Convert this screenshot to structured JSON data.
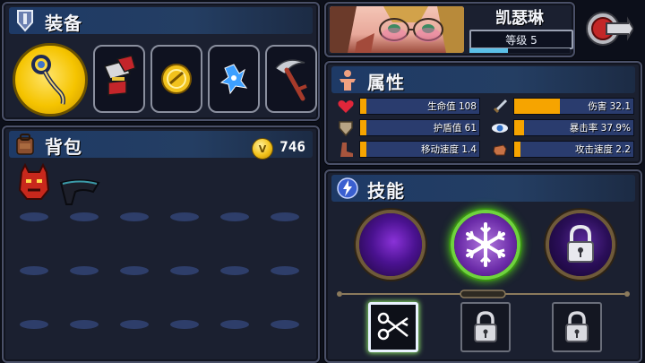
{
  "equipment": {
    "title": "装备",
    "slots": [
      "gold-staff-weapon",
      "potion-flasks",
      "gold-coin-charm",
      "blue-sprite-spirit",
      "scythe-sickle"
    ]
  },
  "backpack": {
    "title": "背包",
    "coin_symbol": "V",
    "coins": "746",
    "items": [
      "red-oni-mask",
      "dark-cloak"
    ]
  },
  "character": {
    "name": "凯瑟琳",
    "level_label": "等级 5",
    "xp_fraction": 0.38
  },
  "attributes": {
    "title": "属性",
    "stats": [
      {
        "label": "生命值 108",
        "icon": "heart-icon",
        "color": "#e0263a",
        "fraction": 0.05
      },
      {
        "label": "伤害 32.1",
        "icon": "sword-icon",
        "color": "#c9d2de",
        "fraction": 0.38
      },
      {
        "label": "护盾值 61",
        "icon": "shield-icon",
        "color": "#b7a384",
        "fraction": 0.05
      },
      {
        "label": "暴击率 37.9%",
        "icon": "eye-icon",
        "color": "#4a8ed8",
        "fraction": 0.08
      },
      {
        "label": "移动速度 1.4",
        "icon": "boot-icon",
        "color": "#a8553d",
        "fraction": 0.05
      },
      {
        "label": "攻击速度 2.2",
        "icon": "fist-icon",
        "color": "#c77246",
        "fraction": 0.05
      }
    ]
  },
  "skills": {
    "title": "技能",
    "orbs": [
      {
        "name": "shadow-orb",
        "state": "unlocked"
      },
      {
        "name": "frost-snowflake",
        "state": "selected"
      },
      {
        "name": "locked-orb",
        "state": "locked"
      }
    ],
    "slots": [
      {
        "name": "scissors-blades",
        "state": "selected"
      },
      {
        "name": "locked-slot",
        "state": "locked"
      },
      {
        "name": "locked-slot",
        "state": "locked"
      }
    ]
  },
  "colors": {
    "panel_bg": "#1b2030",
    "header_bg": "#1e3a66",
    "stat_fill": "#f6a400",
    "stat_bar": "#2a3c6e",
    "accent_green": "#7ce25a"
  }
}
